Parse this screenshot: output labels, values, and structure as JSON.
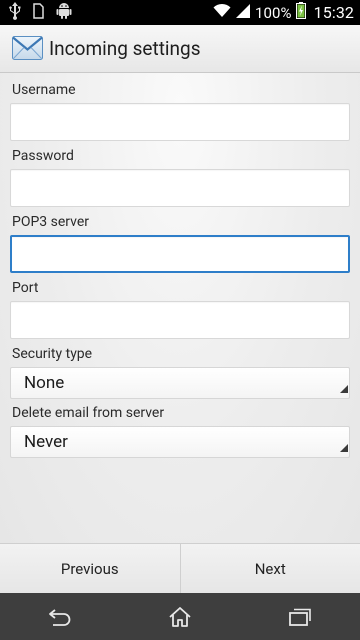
{
  "status_bar": {
    "battery_percent": "100%",
    "time": "15:32",
    "icons": [
      "usb-icon",
      "sim-card-icon",
      "android-icon",
      "wifi-icon",
      "signal-icon",
      "battery-charging-icon"
    ]
  },
  "header": {
    "title": "Incoming settings",
    "icon": "email-envelope-icon"
  },
  "form": {
    "username": {
      "label": "Username",
      "value": ""
    },
    "password": {
      "label": "Password",
      "value": ""
    },
    "pop3_server": {
      "label": "POP3 server",
      "value": ""
    },
    "port": {
      "label": "Port",
      "value": ""
    },
    "security_type": {
      "label": "Security type",
      "value": "None"
    },
    "delete_email": {
      "label": "Delete email from server",
      "value": "Never"
    }
  },
  "buttons": {
    "previous": "Previous",
    "next": "Next"
  },
  "navigation": {
    "icons": [
      "back-icon",
      "home-icon",
      "recent-apps-icon"
    ]
  },
  "colors": {
    "focus": "#2e7ec9",
    "status_bar": "#000000",
    "nav_bar": "#3e3e3e"
  }
}
